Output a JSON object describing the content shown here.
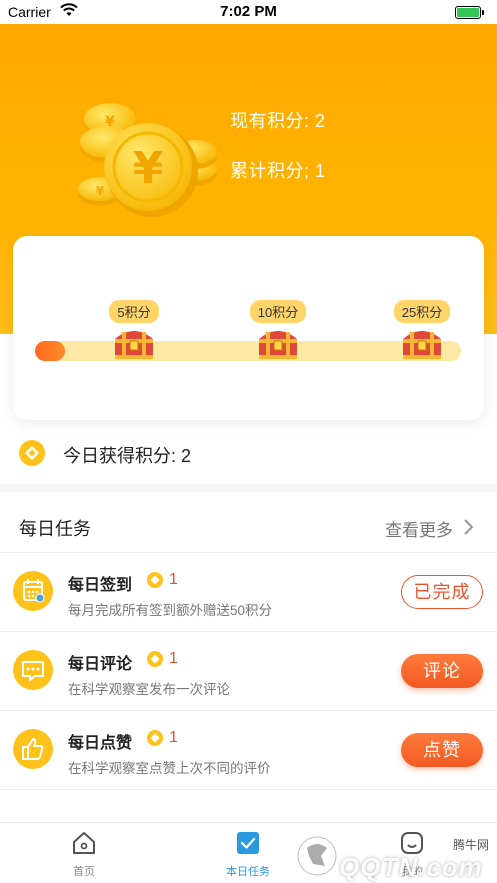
{
  "status_bar": {
    "carrier": "Carrier",
    "time": "7:02 PM"
  },
  "header": {
    "current_points": "现有积分: 2",
    "total_points": "累计积分; 1",
    "bg_color": "#ffb000"
  },
  "progress": {
    "fraction": 0.07,
    "milestones": [
      {
        "label": "5积分"
      },
      {
        "label": "10积分"
      },
      {
        "label": "25积分"
      }
    ]
  },
  "today": {
    "label": "今日获得积分: 2"
  },
  "tasks_section": {
    "title": "每日任务",
    "more": "查看更多"
  },
  "tasks": [
    {
      "name": "每日签到",
      "points": "1",
      "desc": "每月完成所有签到额外赠送50积分",
      "button": "已完成",
      "icon": "calendar-icon"
    },
    {
      "name": "每日评论",
      "points": "1",
      "desc": "在科学观察室发布一次评论",
      "button": "评论",
      "icon": "comment-icon"
    },
    {
      "name": "每日点赞",
      "points": "1",
      "desc": "在科学观察室点赞上次不同的评价",
      "button": "点赞",
      "icon": "thumbs-up-icon"
    }
  ],
  "tabbar": {
    "items": [
      {
        "label": "首页",
        "icon": "home-icon"
      },
      {
        "label": "本日任务",
        "icon": "check-icon"
      },
      {
        "label": "我的",
        "icon": "profile-icon"
      }
    ]
  },
  "watermark": {
    "site": "QQTN.com",
    "small": "腾牛网"
  },
  "colors": {
    "accent": "#f35a22",
    "gold": "#ffc21a",
    "tab_active": "#2a9ae0"
  }
}
